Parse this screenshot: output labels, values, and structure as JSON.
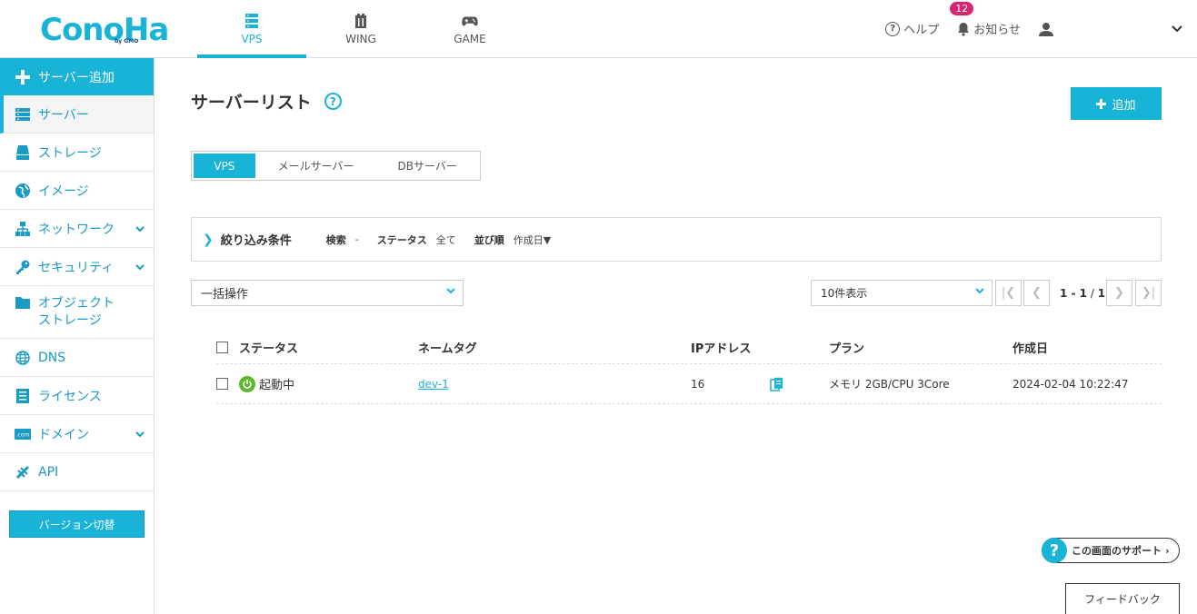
{
  "brand": {
    "logo": "ConoHa",
    "logo_sub": "by GMO",
    "accent": "#1ab3d8"
  },
  "global_nav": [
    {
      "label": "VPS",
      "icon": "server-rack-icon",
      "active": true
    },
    {
      "label": "WING",
      "icon": "building-icon",
      "active": false
    },
    {
      "label": "GAME",
      "icon": "gamepad-icon",
      "active": false
    }
  ],
  "header": {
    "help_label": "ヘルプ",
    "notice_label": "お知らせ",
    "notice_count": "12"
  },
  "sidebar": {
    "add_label": "サーバー追加",
    "items": [
      {
        "label": "サーバー"
      },
      {
        "label": "ストレージ"
      },
      {
        "label": "イメージ"
      },
      {
        "label": "ネットワーク"
      },
      {
        "label": "セキュリティ"
      },
      {
        "label": "オブジェクト"
      },
      {
        "label": "ストレージ"
      },
      {
        "label": "DNS"
      },
      {
        "label": "ライセンス"
      },
      {
        "label": "ドメイン"
      },
      {
        "label": "API"
      }
    ],
    "version_label": "バージョン切替"
  },
  "main": {
    "title": "サーバーリスト",
    "add_label": "追加",
    "tabs": [
      "VPS",
      "メールサーバー",
      "DBサーバー"
    ],
    "filter": {
      "title": "絞り込み条件",
      "search_label": "検索",
      "search_value": "-",
      "status_label": "ステータス",
      "status_value": "全て",
      "sort_label": "並び順",
      "sort_value": "作成日▼"
    },
    "bulk_label": "一括操作",
    "perpage_label": "10件表示",
    "pagination": {
      "range": "1 - 1",
      "separator": " / ",
      "total": "1"
    },
    "table": {
      "headers": [
        "ステータス",
        "ネームタグ",
        "IPアドレス",
        "プラン",
        "作成日"
      ],
      "rows": [
        {
          "status": "起動中",
          "name": "dev-1",
          "ip": "16",
          "plan": "メモリ 2GB/CPU 3Core",
          "created": "2024-02-04 10:22:47"
        }
      ]
    }
  },
  "support_label": "この画面のサポート",
  "feedback_label": "フィードバック"
}
